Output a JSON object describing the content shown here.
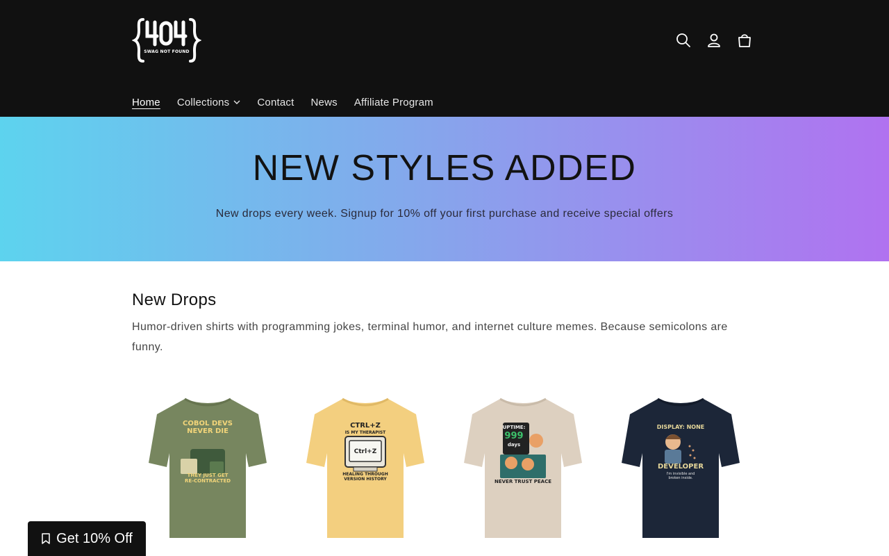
{
  "header": {
    "logo_main": "{404}",
    "logo_sub": "SWAG NOT FOUND",
    "icons": [
      "search-icon",
      "account-icon",
      "cart-icon"
    ],
    "background": "#111111"
  },
  "nav": {
    "items": [
      {
        "label": "Home",
        "active": true
      },
      {
        "label": "Collections",
        "has_dropdown": true
      },
      {
        "label": "Contact"
      },
      {
        "label": "News"
      },
      {
        "label": "Affiliate Program"
      }
    ]
  },
  "hero": {
    "title": "NEW STYLES ADDED",
    "subtitle": "New drops every week. Signup for 10% off your first purchase and receive special offers",
    "gradient": [
      "#5dd3ee",
      "#83a9ec",
      "#9d8aee",
      "#b072f0"
    ]
  },
  "section": {
    "title": "New Drops",
    "description": "Humor-driven shirts with programming jokes, terminal humor, and internet culture memes. Because semicolons are funny."
  },
  "products": [
    {
      "shirt_color": "#77865f",
      "lines": [
        "COBOL DEVS",
        "NEVER DIE",
        "THEY JUST GET",
        "RE-CONTRACTED"
      ]
    },
    {
      "shirt_color": "#f3cf7f",
      "lines": [
        "CTRL+Z",
        "IS MY THERAPIST",
        "Ctrl+Z",
        "HEALING THROUGH",
        "VERSION HISTORY"
      ]
    },
    {
      "shirt_color": "#ddd0c0",
      "lines": [
        "UPTIME:",
        "999",
        "days",
        "NEVER TRUST PEACE"
      ]
    },
    {
      "shirt_color": "#1c2638",
      "lines": [
        "DISPLAY: NONE",
        "DEVELOPER",
        "I'm invisible and",
        "broken inside."
      ]
    }
  ],
  "discount": {
    "label": "Get 10% Off",
    "icon": "tag-icon"
  }
}
